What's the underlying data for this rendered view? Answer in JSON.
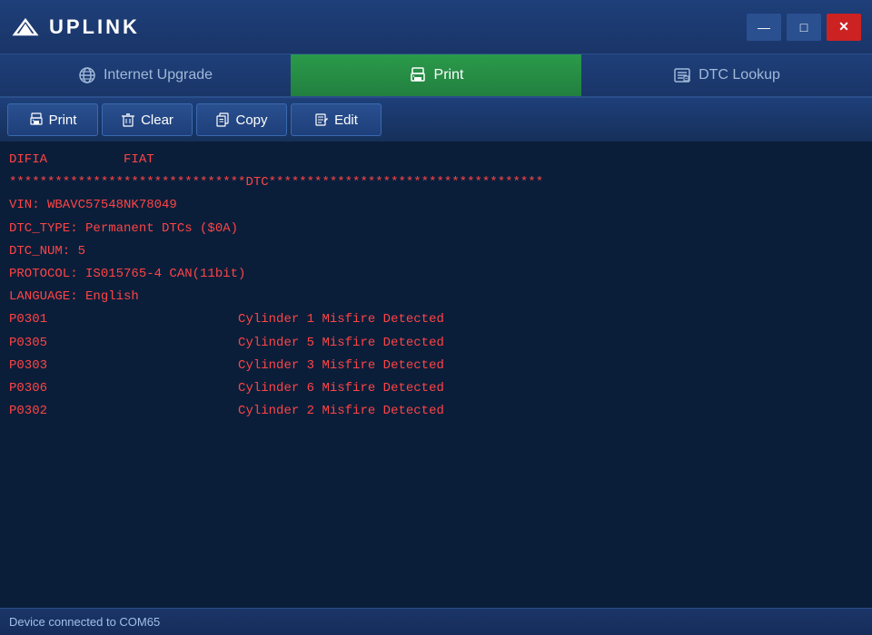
{
  "titleBar": {
    "logoText": "UPLINK",
    "controls": {
      "minimize": "—",
      "maximize": "□",
      "close": "✕"
    }
  },
  "navTabs": [
    {
      "id": "internet-upgrade",
      "label": "Internet Upgrade",
      "active": false,
      "icon": "globe"
    },
    {
      "id": "print",
      "label": "Print",
      "active": true,
      "icon": "print"
    },
    {
      "id": "dtc-lookup",
      "label": "DTC Lookup",
      "active": false,
      "icon": "dtc"
    }
  ],
  "toolbar": {
    "buttons": [
      {
        "id": "print",
        "label": "Print",
        "icon": "🖨"
      },
      {
        "id": "clear",
        "label": "Clear",
        "icon": "🗑"
      },
      {
        "id": "copy",
        "label": "Copy",
        "icon": "📋"
      },
      {
        "id": "edit",
        "label": "Edit",
        "icon": "✏"
      }
    ]
  },
  "content": {
    "lines": [
      "DIFIA          FIAT",
      "",
      "*******************************DTC************************************",
      "VIN: WBAVC57548NK78049",
      "DTC_TYPE: Permanent DTCs ($0A)",
      "DTC_NUM: 5",
      "PROTOCOL: IS015765-4 CAN(11bit)",
      "LANGUAGE: English",
      "",
      "P0301                         Cylinder 1 Misfire Detected",
      "",
      "P0305                         Cylinder 5 Misfire Detected",
      "",
      "P0303                         Cylinder 3 Misfire Detected",
      "",
      "P0306                         Cylinder 6 Misfire Detected",
      "",
      "P0302                         Cylinder 2 Misfire Detected"
    ]
  },
  "statusBar": {
    "text": "Device connected to COM65"
  }
}
